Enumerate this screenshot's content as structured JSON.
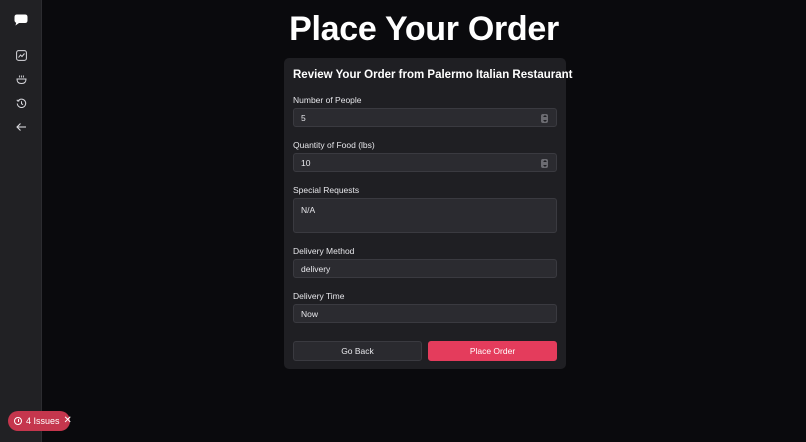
{
  "page": {
    "title": "Place Your Order"
  },
  "sidebar": {
    "items": [
      {
        "icon": "chat-bubble-icon"
      },
      {
        "icon": "analytics-icon"
      },
      {
        "icon": "food-bowl-icon"
      },
      {
        "icon": "history-icon"
      },
      {
        "icon": "arrow-left-icon"
      }
    ]
  },
  "issues_badge": {
    "label": "4 Issues",
    "close": "✕",
    "color": "#c5364d"
  },
  "order_card": {
    "title": "Review Your Order from Palermo Italian Restaurant",
    "fields": {
      "people": {
        "label": "Number of People",
        "value": "5"
      },
      "food_qty": {
        "label": "Quantity of Food (lbs)",
        "value": "10"
      },
      "special_requests": {
        "label": "Special Requests",
        "value": "N/A"
      },
      "delivery_method": {
        "label": "Delivery Method",
        "value": "delivery"
      },
      "delivery_time": {
        "label": "Delivery Time",
        "value": "Now"
      }
    },
    "buttons": {
      "back": "Go Back",
      "place": "Place Order"
    }
  },
  "colors": {
    "background": "#0a0a0d",
    "card": "#1f1f23",
    "accent": "#e43c5c"
  }
}
